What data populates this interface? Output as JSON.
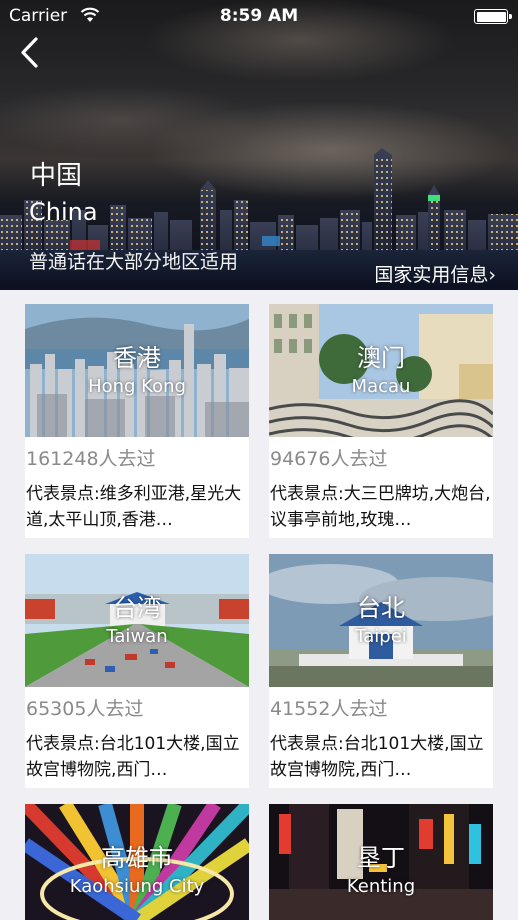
{
  "status_bar": {
    "carrier": "Carrier",
    "time": "8:59 AM"
  },
  "hero": {
    "title_cn": "中国",
    "title_en": "China",
    "description": "普通话在大部分地区适用",
    "info_link": "国家实用信息›"
  },
  "destinations": [
    {
      "name_cn": "香港",
      "name_en": "Hong Kong",
      "visits": "161248人去过",
      "highlights": "代表景点:维多利亚港,星光大道,太平山顶,香港…"
    },
    {
      "name_cn": "澳门",
      "name_en": "Macau",
      "visits": "94676人去过",
      "highlights": "代表景点:大三巴牌坊,大炮台,议事亭前地,玫瑰…"
    },
    {
      "name_cn": "台湾",
      "name_en": "Taiwan",
      "visits": "65305人去过",
      "highlights": "代表景点:台北101大楼,国立故宫博物院,西门…"
    },
    {
      "name_cn": "台北",
      "name_en": "Taipei",
      "visits": "41552人去过",
      "highlights": "代表景点:台北101大楼,国立故宫博物院,西门…"
    },
    {
      "name_cn": "高雄市",
      "name_en": "Kaohsiung City"
    },
    {
      "name_cn": "垦丁",
      "name_en": "Kenting"
    }
  ],
  "icons": {
    "back": "chevron-left-icon",
    "wifi": "wifi-icon",
    "battery": "battery-icon"
  }
}
